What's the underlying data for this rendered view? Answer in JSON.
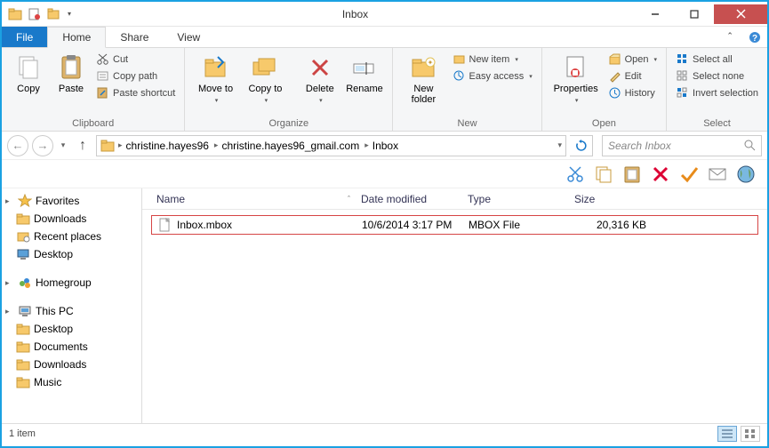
{
  "window": {
    "title": "Inbox"
  },
  "menu": {
    "file": "File",
    "home": "Home",
    "share": "Share",
    "view": "View"
  },
  "ribbon": {
    "clipboard": {
      "label": "Clipboard",
      "copy": "Copy",
      "paste": "Paste",
      "cut": "Cut",
      "copypath": "Copy path",
      "pasteshortcut": "Paste shortcut"
    },
    "organize": {
      "label": "Organize",
      "moveto": "Move\nto",
      "copyto": "Copy\nto",
      "delete": "Delete",
      "rename": "Rename"
    },
    "new": {
      "label": "New",
      "newfolder": "New\nfolder",
      "newitem": "New item",
      "easyaccess": "Easy access"
    },
    "open": {
      "label": "Open",
      "properties": "Properties",
      "open": "Open",
      "edit": "Edit",
      "history": "History"
    },
    "select": {
      "label": "Select",
      "selectall": "Select all",
      "selectnone": "Select none",
      "invert": "Invert selection"
    }
  },
  "breadcrumb": {
    "seg1": "christine.hayes96",
    "seg2": "christine.hayes96_gmail.com",
    "seg3": "Inbox"
  },
  "search": {
    "placeholder": "Search Inbox"
  },
  "nav": {
    "favorites": "Favorites",
    "downloads": "Downloads",
    "recent": "Recent places",
    "desktop": "Desktop",
    "homegroup": "Homegroup",
    "thispc": "This PC",
    "desktop2": "Desktop",
    "documents": "Documents",
    "downloads2": "Downloads",
    "music": "Music"
  },
  "columns": {
    "name": "Name",
    "date": "Date modified",
    "type": "Type",
    "size": "Size"
  },
  "files": [
    {
      "name": "Inbox.mbox",
      "date": "10/6/2014 3:17 PM",
      "type": "MBOX File",
      "size": "20,316 KB"
    }
  ],
  "status": {
    "count": "1 item"
  }
}
